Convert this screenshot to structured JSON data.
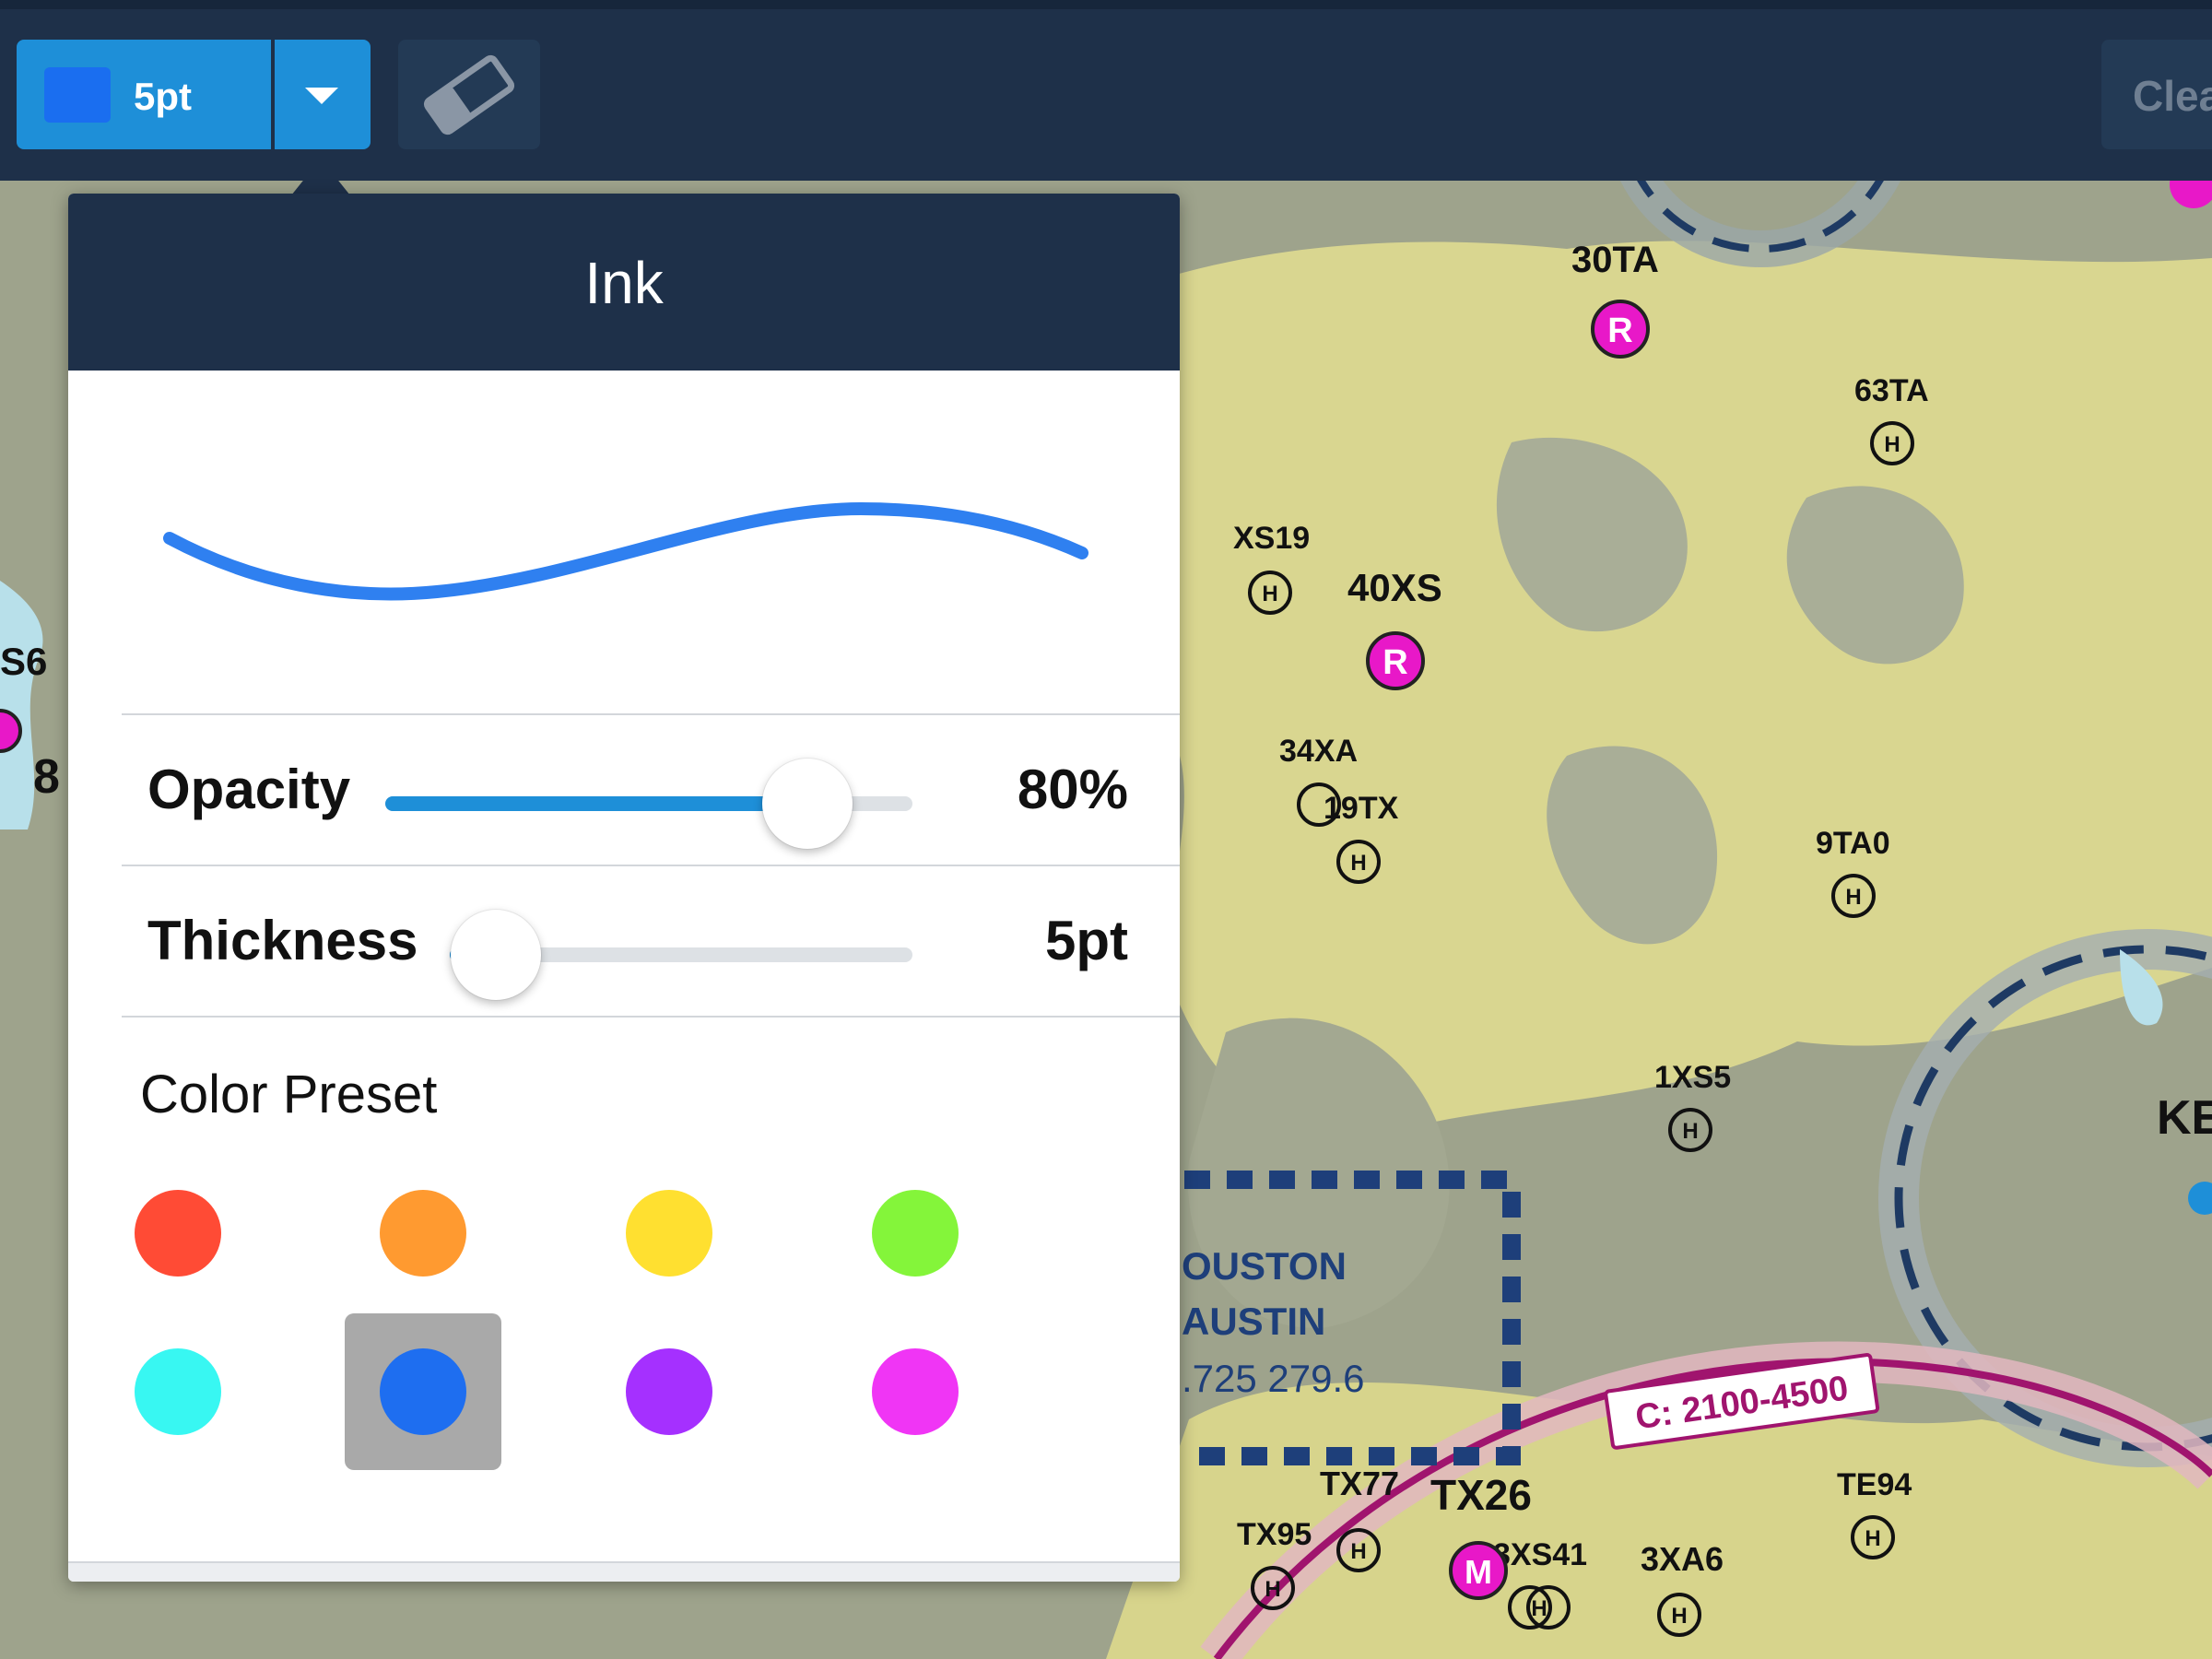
{
  "toolbar": {
    "pen_label": "5pt",
    "pen_color": "#1a6ef0",
    "accent": "#1e8fd8",
    "dropdown_icon": "caret-down-icon",
    "eraser_icon": "eraser-icon",
    "clear_label": "Clea"
  },
  "popover": {
    "title": "Ink",
    "preview_stroke_color": "#2f80f0",
    "opacity": {
      "label": "Opacity",
      "value": 0.8,
      "value_text": "80%"
    },
    "thickness": {
      "label": "Thickness",
      "value": 5,
      "value_text": "5pt"
    },
    "color_preset": {
      "title": "Color Preset",
      "selected_index": 5,
      "colors": [
        "#ff4b35",
        "#ff9a30",
        "#ffe030",
        "#84f53a",
        "#38f7f2",
        "#1e6ef0",
        "#a530ff",
        "#f035f5"
      ]
    }
  },
  "map": {
    "labels": [
      "30TA",
      "63TA",
      "XS19",
      "40XS",
      "34XA",
      "19TX",
      "9TA0",
      "1XS5",
      "KE",
      "S6",
      "8",
      "OUSTON",
      "AUSTIN",
      ".725 279.6",
      "C: 2100-4500",
      "TX77",
      "TX26",
      "TX95",
      "3XS41",
      "3XA6",
      "TE94"
    ],
    "airport_markers": [
      "R",
      "R",
      "M",
      "H"
    ]
  }
}
